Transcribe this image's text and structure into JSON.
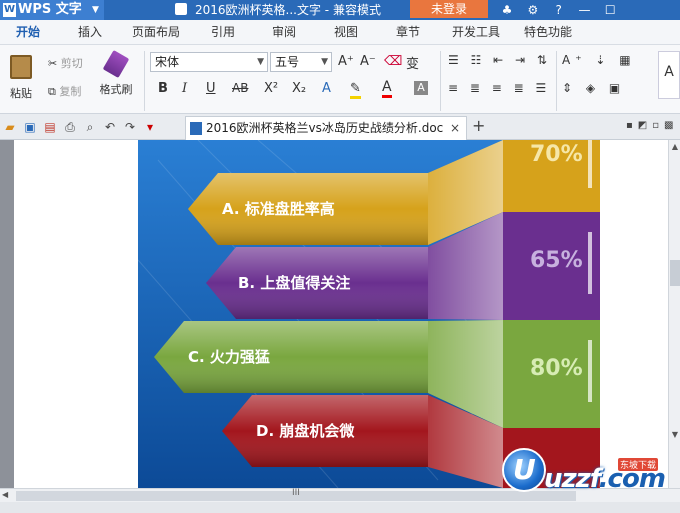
{
  "titlebar": {
    "app_name": "WPS 文字",
    "logo": "W",
    "document_title": "2016欧洲杯英格...文字 - 兼容模式",
    "login_label": "未登录",
    "icons": [
      "skin-icon",
      "settings-icon",
      "help-icon",
      "minimize-icon",
      "maximize-icon"
    ]
  },
  "menu": {
    "tabs": [
      "开始",
      "插入",
      "页面布局",
      "引用",
      "审阅",
      "视图",
      "章节",
      "开发工具",
      "特色功能"
    ]
  },
  "ribbon": {
    "paste": "粘贴",
    "cut": "剪切",
    "copy": "复制",
    "format_painter": "格式刷",
    "font_name": "宋体",
    "font_size": "五号",
    "bold": "B",
    "italic": "I",
    "underline": "U",
    "strike": "AB",
    "superscript": "X²",
    "subscript": "X₂",
    "grow_font": "A⁺",
    "shrink_font": "A⁻",
    "font_color": "A",
    "phonetic": "变"
  },
  "doc_tab": {
    "filename": "2016欧洲杯英格兰vs冰岛历史战绩分析.doc",
    "close": "×",
    "new_tab": "+"
  },
  "infographic": {
    "items": [
      {
        "label": "A. 标准盘胜率高",
        "percent": "70%",
        "color": "#d6a21b"
      },
      {
        "label": "B. 上盘值得关注",
        "percent": "65%",
        "color": "#6a2f8f"
      },
      {
        "label": "C. 火力强猛",
        "percent": "80%",
        "color": "#7aa73f"
      },
      {
        "label": "D. 崩盘机会微",
        "percent": "",
        "color": "#a3161d"
      }
    ]
  },
  "watermark": {
    "brand": "uzzf",
    "domain": ".com",
    "cn_label": "东坡下载"
  },
  "scroll": {
    "grip": "III"
  }
}
